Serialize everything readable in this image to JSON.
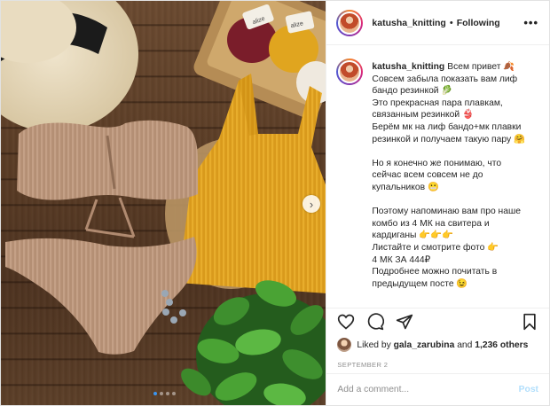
{
  "header": {
    "username": "katusha_knitting",
    "separator": "•",
    "follow_label": "Following",
    "more_label": "•••"
  },
  "photo": {
    "next_glyph": "›",
    "yarn_labels": [
      "alize",
      "alize"
    ],
    "carousel_dot_count": 4,
    "active_dot_index": 0
  },
  "caption": {
    "username": "katusha_knitting",
    "lines": [
      "Всем привет 🍂",
      "Совсем забыла показать вам лиф",
      "бандо резинкой 🥬",
      "Это прекрасная пара плавкам,",
      "связанным резинкой 👙",
      "Берём мк на лиф бандо+мк плавки",
      "резинкой и получаем такую пару 🤗",
      "",
      "Но я конечно же понимаю, что",
      "сейчас всем совсем не до",
      "купальников 😬",
      "",
      "Поэтому напоминаю вам про наше",
      "комбо из 4 МК на свитера и",
      "кардиганы 👉👉👉",
      "Листайте и смотрите фото 👉",
      "4 МК ЗА 444₽",
      "Подробнее можно почитать в",
      "предыдущем посте 😉"
    ]
  },
  "actions": {
    "icons": [
      "heart-icon",
      "comment-icon",
      "share-icon",
      "bookmark-icon"
    ]
  },
  "likes": {
    "prefix": "Liked by",
    "user": "gala_zarubina",
    "middle": "and",
    "others": "1,236 others"
  },
  "date": "SEPTEMBER 2",
  "add_comment": {
    "placeholder": "Add a comment...",
    "post_label": "Post"
  },
  "colors": {
    "accent": "#3b95f0",
    "post_button": "#b2dffc",
    "muted": "#8e8e8e",
    "text": "#262626"
  }
}
